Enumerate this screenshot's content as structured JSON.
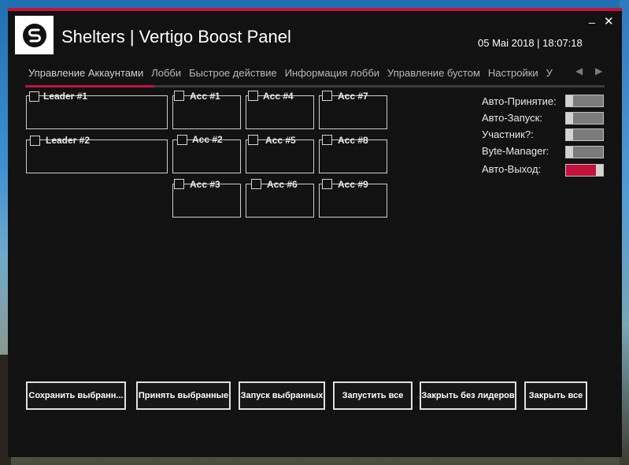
{
  "app": {
    "title": "Shelters | Vertigo Boost Panel",
    "datetime": "05 Mai 2018 | 18:07:18",
    "minimize_symbol": "_",
    "close_symbol": "✕",
    "accent_color": "#c5123c"
  },
  "tabs": [
    {
      "label": "Управление Аккаунтами",
      "active": true
    },
    {
      "label": "Лобби"
    },
    {
      "label": "Быстрое действие"
    },
    {
      "label": "Информация лобби"
    },
    {
      "label": "Управление бустом"
    },
    {
      "label": "Настройки"
    },
    {
      "label": "У"
    }
  ],
  "tab_nav": {
    "left_arrow": "◀",
    "right_arrow": "▶"
  },
  "slots": {
    "leader1": "Leader #1",
    "leader2": "Leader #2",
    "acc1": "Acc #1",
    "acc2": "Acc #2",
    "acc3": "Acc #3",
    "acc4": "Acc #4",
    "acc5": "Acc #5",
    "acc6": "Acc #6",
    "acc7": "Acc #7",
    "acc8": "Acc #8",
    "acc9": "Acc #9"
  },
  "options": [
    {
      "label": "Авто-Принятие:",
      "on": false
    },
    {
      "label": "Авто-Запуск:",
      "on": false
    },
    {
      "label": "Участник?:",
      "on": false
    },
    {
      "label": "Byte-Manager:",
      "on": false
    },
    {
      "label": "Авто-Выход:",
      "on": true
    }
  ],
  "buttons": {
    "save_selected": "Сохранить выбранн...",
    "accept_selected": "Принять выбранные",
    "launch_selected": "Запуск выбранных",
    "launch_all": "Запустить все",
    "close_without_leaders": "Закрыть без лидеров",
    "close_all": "Закрыть все"
  }
}
